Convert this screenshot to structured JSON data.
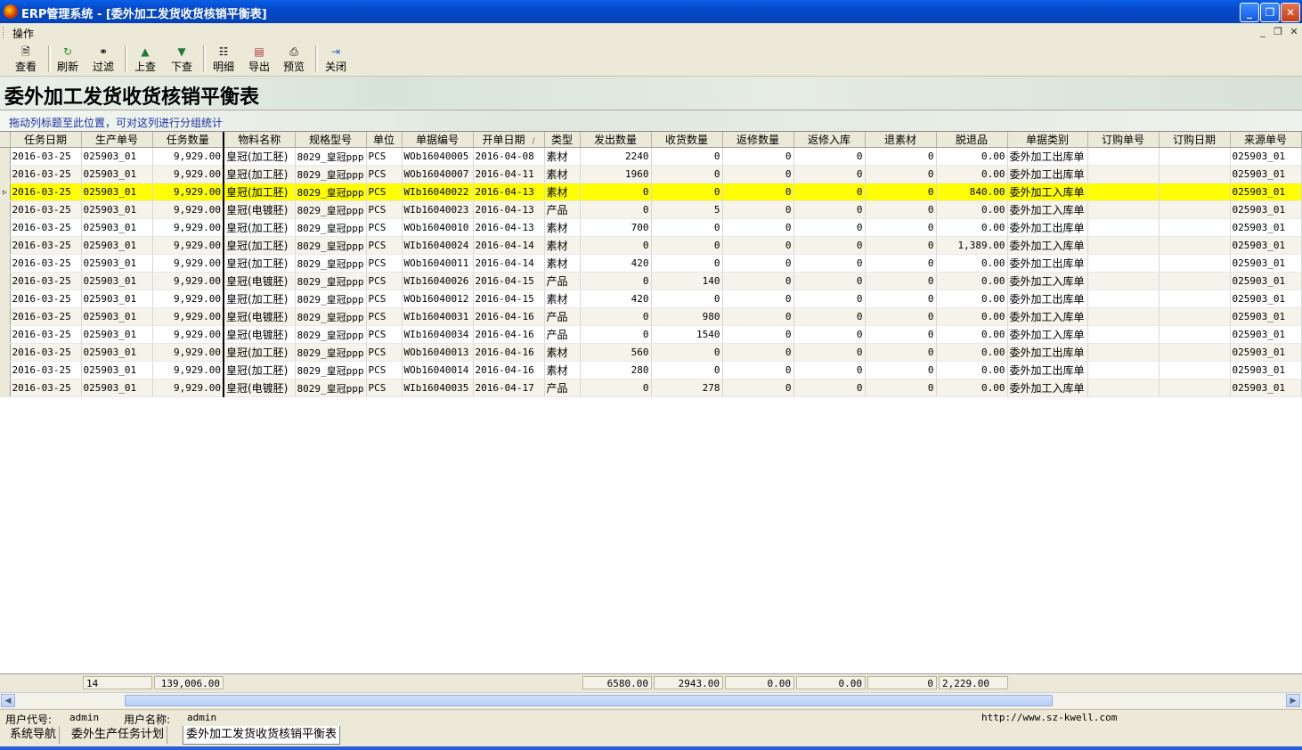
{
  "window": {
    "title": "ERP管理系统 - [委外加工发货收货核销平衡表]"
  },
  "menubar": {
    "item": "操作"
  },
  "toolbar": [
    {
      "label": "查看",
      "icon": "view-icon"
    },
    {
      "label": "刷新",
      "icon": "refresh-icon"
    },
    {
      "label": "过滤",
      "icon": "binoculars-icon"
    },
    {
      "label": "上查",
      "icon": "arrow-up-icon"
    },
    {
      "label": "下查",
      "icon": "arrow-down-icon"
    },
    {
      "label": "明细",
      "icon": "detail-icon"
    },
    {
      "label": "导出",
      "icon": "export-icon"
    },
    {
      "label": "预览",
      "icon": "printer-icon"
    },
    {
      "label": "关闭",
      "icon": "exit-icon"
    }
  ],
  "page_title": "委外加工发货收货核销平衡表",
  "group_hint": "拖动列标题至此位置，可对这列进行分组统计",
  "columns": [
    "任务日期",
    "生产单号",
    "任务数量",
    "物料名称",
    "规格型号",
    "单位",
    "单据编号",
    "开单日期",
    "类型",
    "发出数量",
    "收货数量",
    "返修数量",
    "返修入库",
    "退素材",
    "脱退品",
    "单据类别",
    "订购单号",
    "订购日期",
    "来源单号"
  ],
  "sort_indicator": "/",
  "rows": [
    [
      "2016-03-25",
      "025903_01",
      "9,929.00",
      "皇冠(加工胚)",
      "8029_皇冠ppp",
      "PCS",
      "WOb16040005",
      "2016-04-08",
      "素材",
      "2240",
      "0",
      "0",
      "0",
      "0",
      "0.00",
      "委外加工出库单",
      "",
      "",
      "025903_01"
    ],
    [
      "2016-03-25",
      "025903_01",
      "9,929.00",
      "皇冠(加工胚)",
      "8029_皇冠ppp",
      "PCS",
      "WOb16040007",
      "2016-04-11",
      "素材",
      "1960",
      "0",
      "0",
      "0",
      "0",
      "0.00",
      "委外加工出库单",
      "",
      "",
      "025903_01"
    ],
    [
      "2016-03-25",
      "025903_01",
      "9,929.00",
      "皇冠(加工胚)",
      "8029_皇冠ppp",
      "PCS",
      "WIb16040022",
      "2016-04-13",
      "素材",
      "0",
      "0",
      "0",
      "0",
      "0",
      "840.00",
      "委外加工入库单",
      "",
      "",
      "025903_01"
    ],
    [
      "2016-03-25",
      "025903_01",
      "9,929.00",
      "皇冠(电镀胚)",
      "8029_皇冠ppp",
      "PCS",
      "WIb16040023",
      "2016-04-13",
      "产品",
      "0",
      "5",
      "0",
      "0",
      "0",
      "0.00",
      "委外加工入库单",
      "",
      "",
      "025903_01"
    ],
    [
      "2016-03-25",
      "025903_01",
      "9,929.00",
      "皇冠(加工胚)",
      "8029_皇冠ppp",
      "PCS",
      "WOb16040010",
      "2016-04-13",
      "素材",
      "700",
      "0",
      "0",
      "0",
      "0",
      "0.00",
      "委外加工出库单",
      "",
      "",
      "025903_01"
    ],
    [
      "2016-03-25",
      "025903_01",
      "9,929.00",
      "皇冠(加工胚)",
      "8029_皇冠ppp",
      "PCS",
      "WIb16040024",
      "2016-04-14",
      "素材",
      "0",
      "0",
      "0",
      "0",
      "0",
      "1,389.00",
      "委外加工入库单",
      "",
      "",
      "025903_01"
    ],
    [
      "2016-03-25",
      "025903_01",
      "9,929.00",
      "皇冠(加工胚)",
      "8029_皇冠ppp",
      "PCS",
      "WOb16040011",
      "2016-04-14",
      "素材",
      "420",
      "0",
      "0",
      "0",
      "0",
      "0.00",
      "委外加工出库单",
      "",
      "",
      "025903_01"
    ],
    [
      "2016-03-25",
      "025903_01",
      "9,929.00",
      "皇冠(电镀胚)",
      "8029_皇冠ppp",
      "PCS",
      "WIb16040026",
      "2016-04-15",
      "产品",
      "0",
      "140",
      "0",
      "0",
      "0",
      "0.00",
      "委外加工入库单",
      "",
      "",
      "025903_01"
    ],
    [
      "2016-03-25",
      "025903_01",
      "9,929.00",
      "皇冠(加工胚)",
      "8029_皇冠ppp",
      "PCS",
      "WOb16040012",
      "2016-04-15",
      "素材",
      "420",
      "0",
      "0",
      "0",
      "0",
      "0.00",
      "委外加工出库单",
      "",
      "",
      "025903_01"
    ],
    [
      "2016-03-25",
      "025903_01",
      "9,929.00",
      "皇冠(电镀胚)",
      "8029_皇冠ppp",
      "PCS",
      "WIb16040031",
      "2016-04-16",
      "产品",
      "0",
      "980",
      "0",
      "0",
      "0",
      "0.00",
      "委外加工入库单",
      "",
      "",
      "025903_01"
    ],
    [
      "2016-03-25",
      "025903_01",
      "9,929.00",
      "皇冠(电镀胚)",
      "8029_皇冠ppp",
      "PCS",
      "WIb16040034",
      "2016-04-16",
      "产品",
      "0",
      "1540",
      "0",
      "0",
      "0",
      "0.00",
      "委外加工入库单",
      "",
      "",
      "025903_01"
    ],
    [
      "2016-03-25",
      "025903_01",
      "9,929.00",
      "皇冠(加工胚)",
      "8029_皇冠ppp",
      "PCS",
      "WOb16040013",
      "2016-04-16",
      "素材",
      "560",
      "0",
      "0",
      "0",
      "0",
      "0.00",
      "委外加工出库单",
      "",
      "",
      "025903_01"
    ],
    [
      "2016-03-25",
      "025903_01",
      "9,929.00",
      "皇冠(加工胚)",
      "8029_皇冠ppp",
      "PCS",
      "WOb16040014",
      "2016-04-16",
      "素材",
      "280",
      "0",
      "0",
      "0",
      "0",
      "0.00",
      "委外加工出库单",
      "",
      "",
      "025903_01"
    ],
    [
      "2016-03-25",
      "025903_01",
      "9,929.00",
      "皇冠(电镀胚)",
      "8029_皇冠ppp",
      "PCS",
      "WIb16040035",
      "2016-04-17",
      "产品",
      "0",
      "278",
      "0",
      "0",
      "0",
      "0.00",
      "委外加工入库单",
      "",
      "",
      "025903_01"
    ]
  ],
  "selected_row": 2,
  "footer": {
    "count": "14",
    "task_qty": "139,006.00",
    "sent": "6580.00",
    "received": "2943.00",
    "repair": "0.00",
    "repair_in": "0.00",
    "returned": "0",
    "defective": "2,229.00"
  },
  "status": {
    "user_code_label": "用户代号:",
    "user_code": "admin",
    "user_name_label": "用户名称:",
    "user_name": "admin",
    "url": "http://www.sz-kwell.com"
  },
  "tabs": [
    "系统导航",
    "委外生产任务计划",
    "委外加工发货收货核销平衡表"
  ],
  "active_tab": 2,
  "colors": {
    "titlebar": "#0648c8",
    "selected_row": "#ffff00",
    "hint_text": "#1a2fa8"
  }
}
